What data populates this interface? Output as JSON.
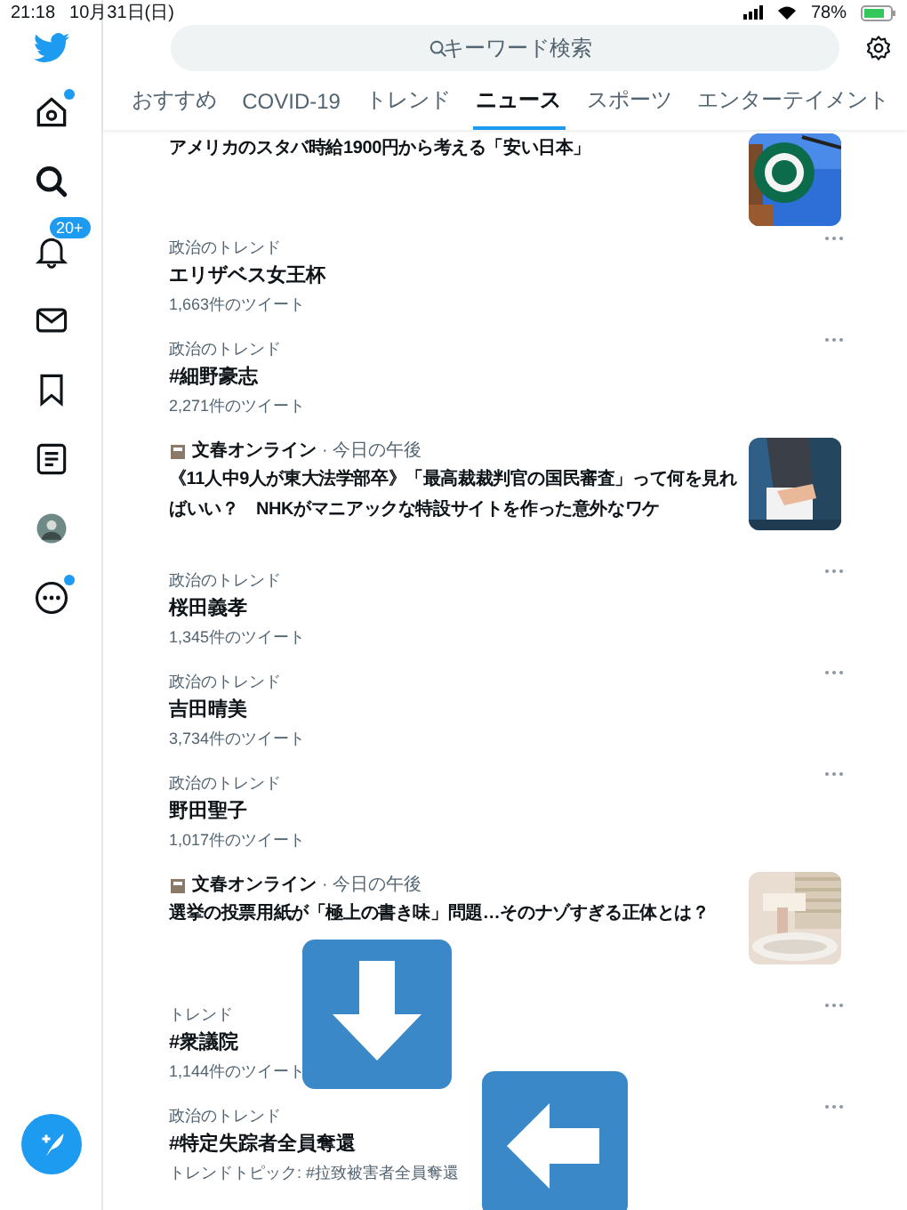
{
  "status_bar": {
    "time": "21:18",
    "date": "10月31日(日)",
    "battery": "78%"
  },
  "sidebar": {
    "items": [
      {
        "kind": "home",
        "dot": true
      },
      {
        "kind": "search",
        "dot": false
      },
      {
        "kind": "bell",
        "badge": "20+",
        "dot": false
      },
      {
        "kind": "mail",
        "dot": false
      },
      {
        "kind": "bookmark",
        "dot": false
      },
      {
        "kind": "list",
        "dot": false
      },
      {
        "kind": "avatar",
        "dot": false
      },
      {
        "kind": "more",
        "dot": true
      }
    ]
  },
  "search": {
    "placeholder": "キーワード検索"
  },
  "tabs": [
    {
      "label": "おすすめ",
      "selected": false
    },
    {
      "label": "COVID-19",
      "selected": false
    },
    {
      "label": "トレンド",
      "selected": false
    },
    {
      "label": "ニュース",
      "selected": true
    },
    {
      "label": "スポーツ",
      "selected": false
    },
    {
      "label": "エンターテイメント",
      "selected": false
    }
  ],
  "feed": [
    {
      "kind": "news",
      "headline": "アメリカのスタバ時給1900円から考える「安い日本」"
    },
    {
      "kind": "trend",
      "category": "政治のトレンド",
      "title": "エリザベス女王杯",
      "meta": "1,663件のツイート"
    },
    {
      "kind": "trend",
      "category": "政治のトレンド",
      "title": "#細野豪志",
      "meta": "2,271件のツイート"
    },
    {
      "kind": "news",
      "source": "文春オンライン",
      "time": "· 今日の午後",
      "headline": "《11人中9人が東大法学部卒》「最高裁裁判官の国民審査」って何を見ればいい？　NHKがマニアックな特設サイトを作った意外なワケ"
    },
    {
      "kind": "trend",
      "category": "政治のトレンド",
      "title": "桜田義孝",
      "meta": "1,345件のツイート"
    },
    {
      "kind": "trend",
      "category": "政治のトレンド",
      "title": "吉田晴美",
      "meta": "3,734件のツイート"
    },
    {
      "kind": "trend",
      "category": "政治のトレンド",
      "title": "野田聖子",
      "meta": "1,017件のツイート"
    },
    {
      "kind": "news",
      "source": "文春オンライン",
      "time": "· 今日の午後",
      "headline": "選挙の投票用紙が「極上の書き味」問題…そのナゾすぎる正体とは？"
    },
    {
      "kind": "trend",
      "category": "トレンド",
      "title": "#衆議院",
      "meta": "1,144件のツイート"
    },
    {
      "kind": "trend",
      "category": "政治のトレンド",
      "title": "#特定失踪者全員奪還",
      "meta": "トレンドトピック: #拉致被害者全員奪還"
    }
  ]
}
